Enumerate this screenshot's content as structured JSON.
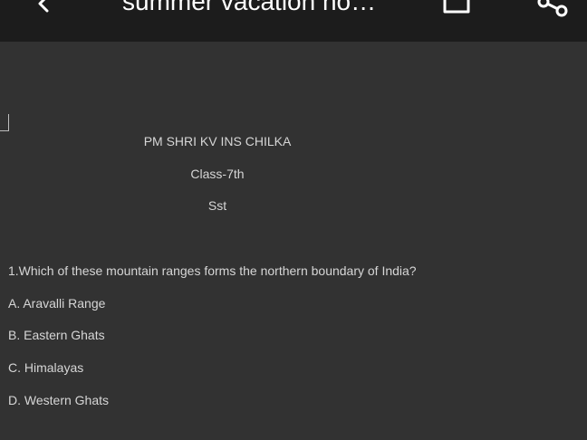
{
  "header": {
    "title": "summer vacation ho…",
    "icons": {
      "back": "back-arrow-icon",
      "save": "save-icon",
      "share": "share-icon"
    }
  },
  "document": {
    "school": "PM SHRI KV INS CHILKA",
    "class_label": "Class-7th",
    "subject": "Sst",
    "question": "1.Which of these mountain ranges forms the northern boundary of India?",
    "options": [
      "A. Aravalli Range",
      "B. Eastern Ghats",
      "C. Himalayas",
      "D. Western Ghats"
    ]
  },
  "colors": {
    "toolbar": "#1c1c1c",
    "background": "#323232",
    "text": "#d6d6d6"
  }
}
